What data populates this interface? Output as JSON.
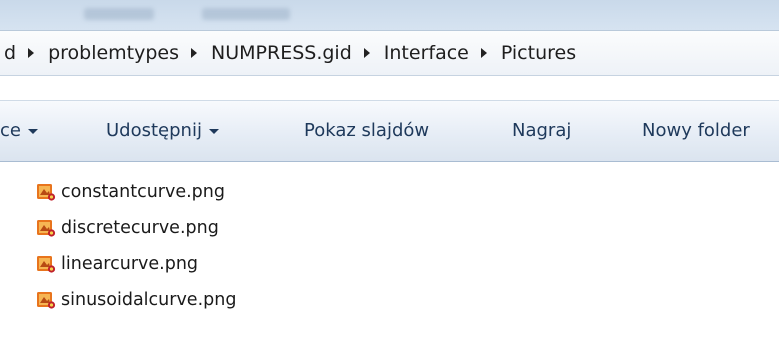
{
  "breadcrumb": {
    "items": [
      "d",
      "problemtypes",
      "NUMPRESS.gid",
      "Interface",
      "Pictures"
    ]
  },
  "toolbar": {
    "partial_label": "ce",
    "share_label": "Udostępnij",
    "slideshow_label": "Pokaz slajdów",
    "burn_label": "Nagraj",
    "new_folder_label": "Nowy folder"
  },
  "files": [
    {
      "name": "constantcurve.png",
      "icon": "png-image-icon"
    },
    {
      "name": "discretecurve.png",
      "icon": "png-image-icon"
    },
    {
      "name": "linearcurve.png",
      "icon": "png-image-icon"
    },
    {
      "name": "sinusoidalcurve.png",
      "icon": "png-image-icon"
    }
  ],
  "colors": {
    "toolbar_text": "#1e395b",
    "icon_orange": "#e8741d",
    "icon_red": "#c0202a"
  }
}
